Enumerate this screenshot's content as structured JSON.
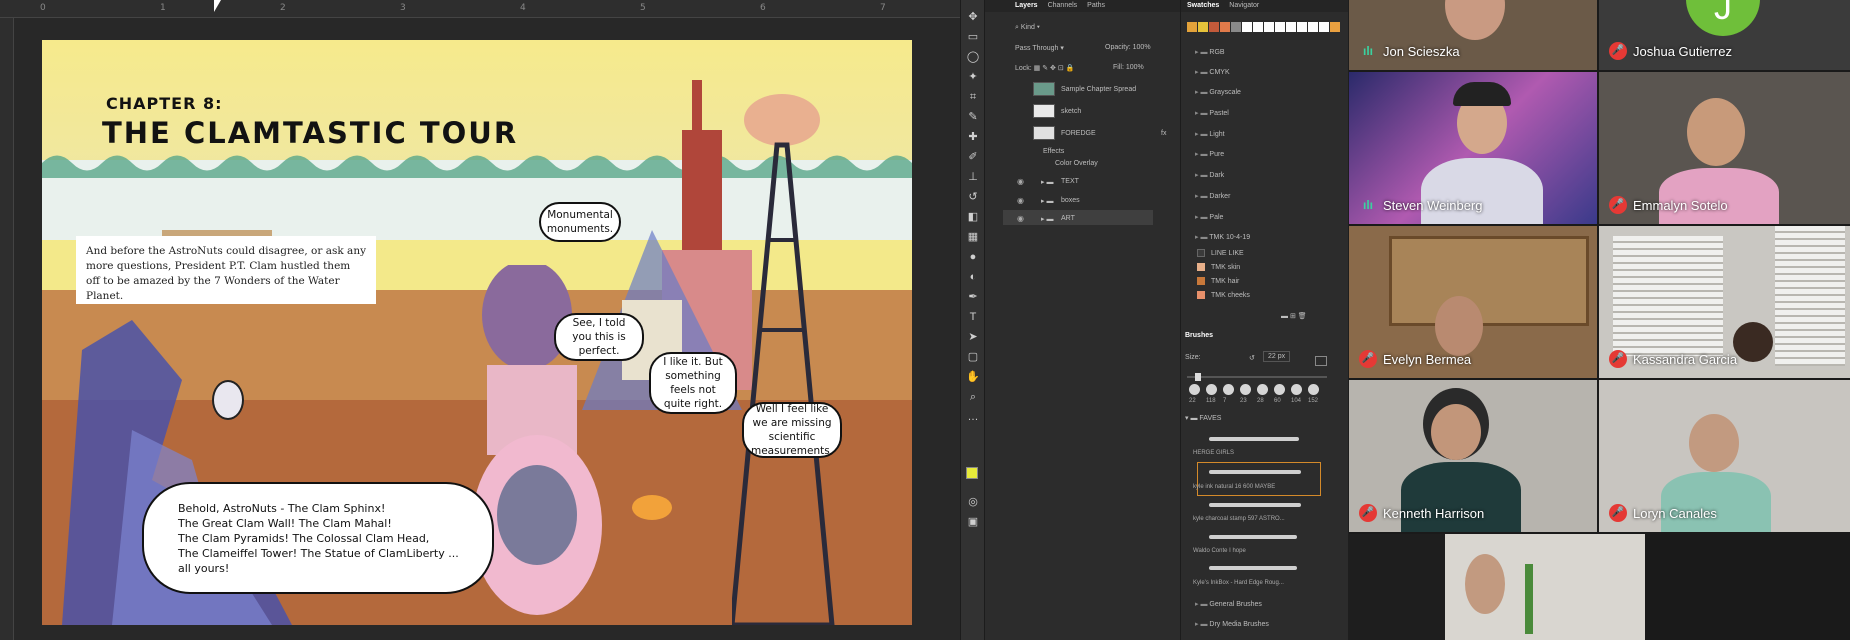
{
  "artboard": {
    "chapter_kicker": "CHAPTER 8:",
    "chapter_title": "THE CLAMTASTIC TOUR",
    "intro_text": "And before the AstroNuts could disagree, or ask any more questions, President P.T. Clam hustled them off to be amazed by the 7 Wonders of the Water Planet.",
    "bubbles": {
      "monumental": "Monumental monuments.",
      "told_you": "See, I told you this is perfect.",
      "like_it": "I like it. But something feels not quite right.",
      "missing": "Well I feel like we are missing scientific measurements.",
      "behold_l1": "Behold, AstroNuts - The Clam Sphinx!",
      "behold_l2": "The Great Clam Wall! The Clam Mahal!",
      "behold_l3": "The Clam Pyramids! The Colossal Clam Head,",
      "behold_l4": "The Clameiffel Tower! The Statue of ClamLiberty ...",
      "behold_l5": "all yours!"
    }
  },
  "layers_panel": {
    "tabs": [
      "Layers",
      "Channels",
      "Paths"
    ],
    "kind_filter": "Kind",
    "blend_mode": "Pass Through",
    "opacity_label": "Opacity:",
    "opacity_value": "100%",
    "lock_label": "Lock:",
    "fill_label": "Fill:",
    "fill_value": "100%",
    "layers": [
      "Sample Chapter Spread",
      "sketch",
      "FOREDGE",
      "Effects",
      "Color Overlay",
      "TEXT",
      "boxes",
      "ART"
    ]
  },
  "swatches_panel": {
    "tabs": [
      "Swatches",
      "Navigator"
    ],
    "swatch_colors": [
      "#e3a23a",
      "#e6c23a",
      "#c25a3a",
      "#e07a4a",
      "#8a8a8a",
      "#ffffff",
      "#ffffff",
      "#ffffff",
      "#ffffff",
      "#ffffff",
      "#ffffff",
      "#ffffff",
      "#ffffff",
      "#e9a040"
    ],
    "folders": [
      "RGB",
      "CMYK",
      "Grayscale",
      "Pastel",
      "Light",
      "Pure",
      "Dark",
      "Darker",
      "Pale",
      "TMK 10-4-19"
    ],
    "sub_items": [
      "LINE LIKE",
      "TMK skin",
      "TMK hair",
      "TMK cheeks"
    ],
    "sub_colors": [
      "#3a3a3a",
      "#e8b08a",
      "#c8783a",
      "#e8906a"
    ]
  },
  "brushes_panel": {
    "title": "Brushes",
    "size_label": "Size:",
    "size_value": "22 px",
    "presets": [
      "22",
      "118",
      "7",
      "23",
      "28",
      "60",
      "104",
      "152"
    ],
    "group": "FAVES",
    "brushes": [
      "HERGE GIRLS",
      "kyle ink natural 16 600 MAYBE",
      "kyle charcoal stamp 597 ASTRO...",
      "Waldo Conte I hope",
      "Kyle's InkBox - Hard Edge Roug..."
    ],
    "groups_bottom": [
      "General Brushes",
      "Dry Media Brushes"
    ]
  },
  "video_call": {
    "participants": [
      {
        "name": "Jon Scieszka",
        "muted": false
      },
      {
        "name": "Joshua Gutierrez",
        "muted": true
      },
      {
        "name": "Steven Weinberg",
        "muted": false
      },
      {
        "name": "Emmalyn Sotelo",
        "muted": true
      },
      {
        "name": "Evelyn Bermea",
        "muted": true
      },
      {
        "name": "Kassandra Garcia",
        "muted": true
      },
      {
        "name": "Kenneth Harrison",
        "muted": true
      },
      {
        "name": "Loryn Canales",
        "muted": true
      }
    ],
    "avatar_letter": "J"
  },
  "colors": {
    "accent_green": "#6fbf3a",
    "mute_red": "#e53935",
    "audio_green": "#3ad29f"
  }
}
